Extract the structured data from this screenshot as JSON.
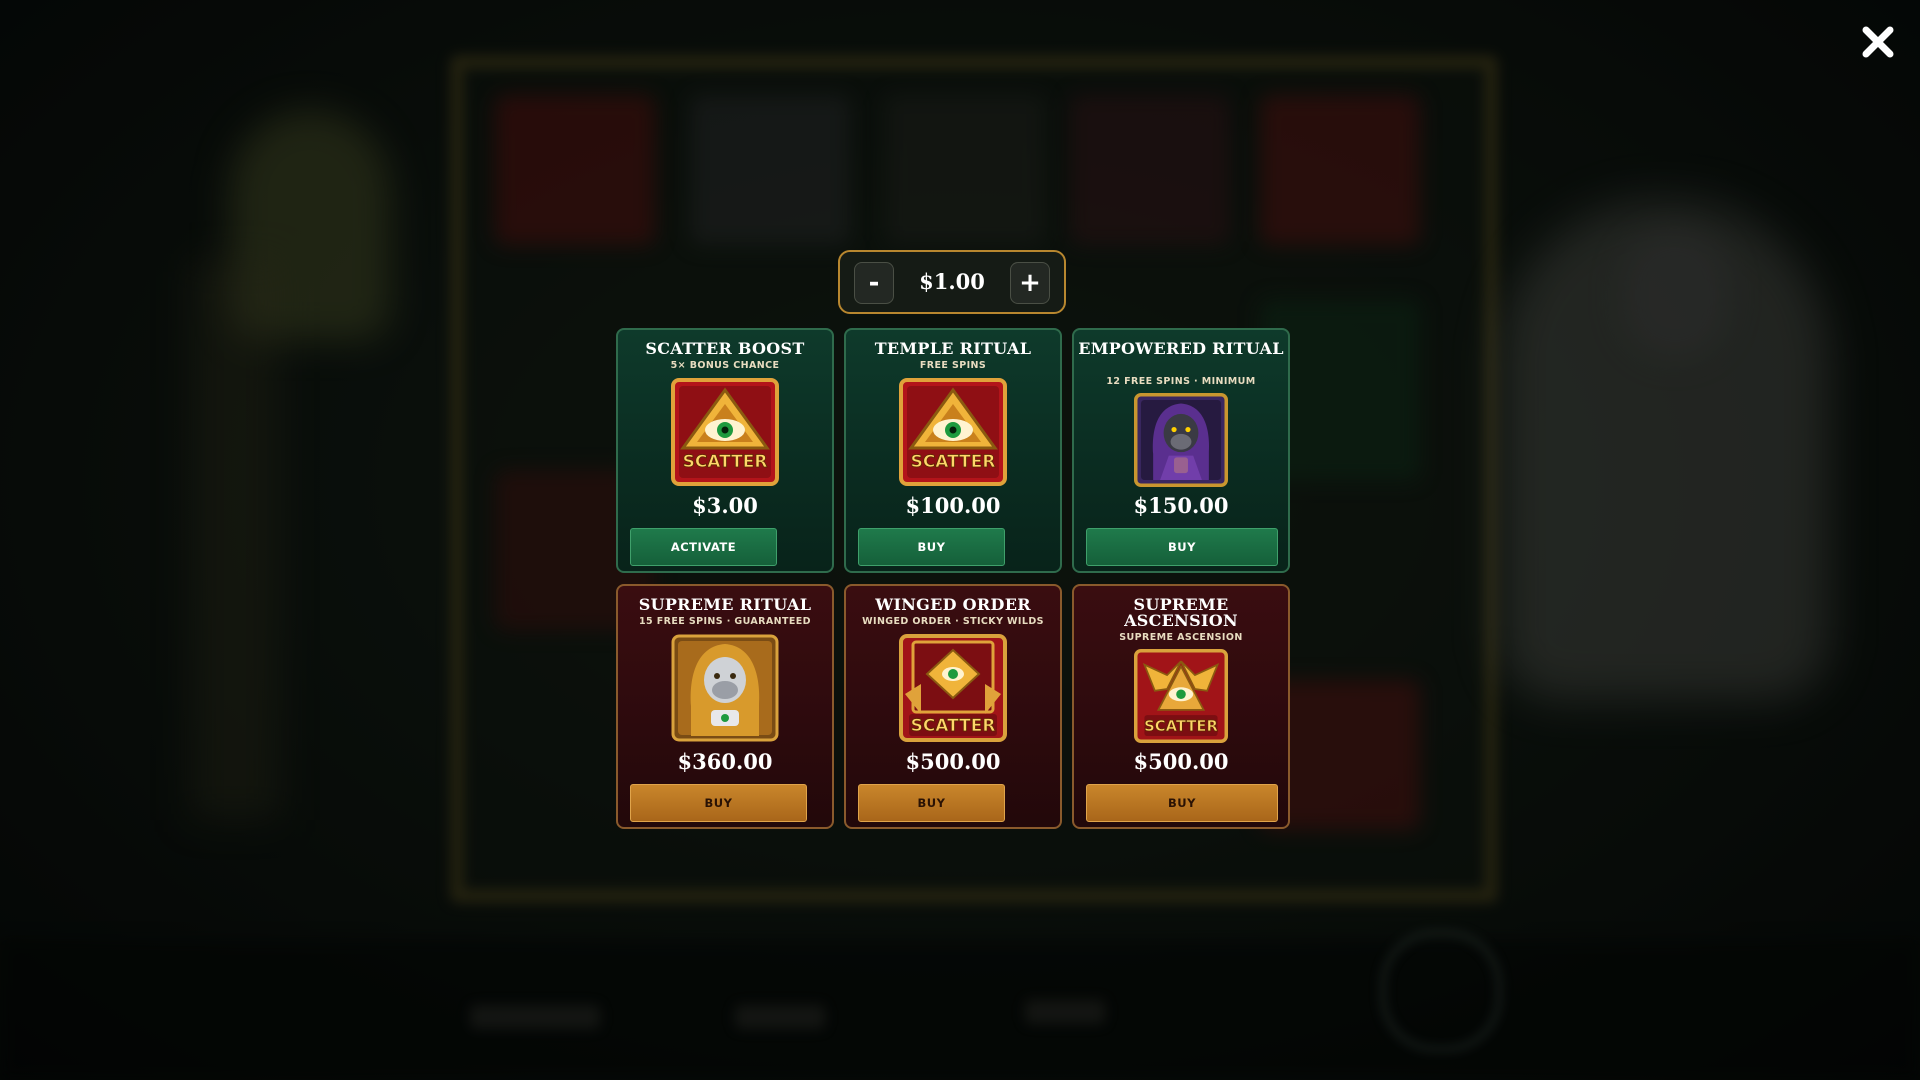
{
  "close_icon": "close-icon",
  "bet": {
    "minus_label": "-",
    "value": "$1.00",
    "plus_label": "+"
  },
  "cards": [
    {
      "title": "SCATTER BOOST",
      "subtitle": "5× BONUS CHANCE",
      "icon": "scatter-eye-icon",
      "price": "$3.00",
      "button": "ACTIVATE",
      "theme": "green"
    },
    {
      "title": "TEMPLE RITUAL",
      "subtitle": "FREE SPINS",
      "icon": "scatter-eye-icon",
      "price": "$100.00",
      "button": "BUY",
      "theme": "green"
    },
    {
      "title": "EMPOWERED RITUAL",
      "subtitle": "12 FREE SPINS · MINIMUM",
      "icon": "purple-gorilla-icon",
      "price": "$150.00",
      "button": "BUY",
      "theme": "green"
    },
    {
      "title": "SUPREME RITUAL",
      "subtitle": "15 FREE SPINS · GUARANTEED",
      "icon": "golden-gorilla-icon",
      "price": "$360.00",
      "button": "BUY",
      "theme": "red"
    },
    {
      "title": "WINGED ORDER",
      "subtitle": "WINGED ORDER · STICKY WILDS",
      "icon": "winged-scatter-book-icon",
      "price": "$500.00",
      "button": "BUY",
      "theme": "red"
    },
    {
      "title": "SUPREME ASCENSION",
      "subtitle": "SUPREME ASCENSION",
      "icon": "winged-scatter-icon",
      "price": "$500.00",
      "button": "BUY",
      "theme": "red"
    }
  ],
  "colors": {
    "green_button": "#1f7a4b",
    "gold_button": "#c9862b",
    "gold_border": "#b8872f"
  }
}
